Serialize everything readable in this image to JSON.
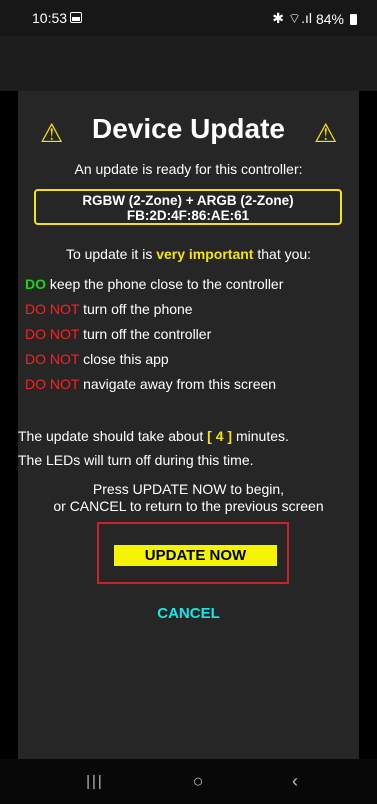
{
  "status_bar": {
    "time": "10:53",
    "right_icons": "✱ ⌔.ıl",
    "battery_text": "84%"
  },
  "dialog": {
    "title": "Device Update",
    "warning_glyph": "⚠",
    "subtitle": "An update is ready for this controller:",
    "device_line1": "RGBW (2-Zone) + ARGB (2-Zone)",
    "device_line2": "FB:2D:4F:86:AE:61",
    "important_prefix": "To update it is ",
    "important_emph": "very important",
    "important_suffix": " that you:",
    "rules": [
      {
        "prefix": "DO",
        "text": " keep the phone close to the controller",
        "color": "#1cd31c"
      },
      {
        "prefix": "DO NOT",
        "text": " turn off the phone",
        "color": "#ff2020"
      },
      {
        "prefix": "DO NOT",
        "text": " turn off the controller",
        "color": "#ff2020"
      },
      {
        "prefix": "DO NOT",
        "text": " close this app",
        "color": "#ff2020"
      },
      {
        "prefix": "DO NOT",
        "text": " navigate away from this screen",
        "color": "#ff2020"
      }
    ],
    "time_prefix": "The update should take about ",
    "time_bracket_open": "[",
    "time_value": "4",
    "time_bracket_close": "]",
    "time_suffix": " minutes.",
    "leds_note": "The LEDs will turn off during this time.",
    "prompt_line1": "Press UPDATE NOW to begin,",
    "prompt_line2": "or CANCEL to return to the previous screen",
    "update_button": "UPDATE NOW",
    "cancel_button": "CANCEL"
  },
  "nav_bar": {
    "recents": "|||",
    "home": "○",
    "back": "‹"
  }
}
